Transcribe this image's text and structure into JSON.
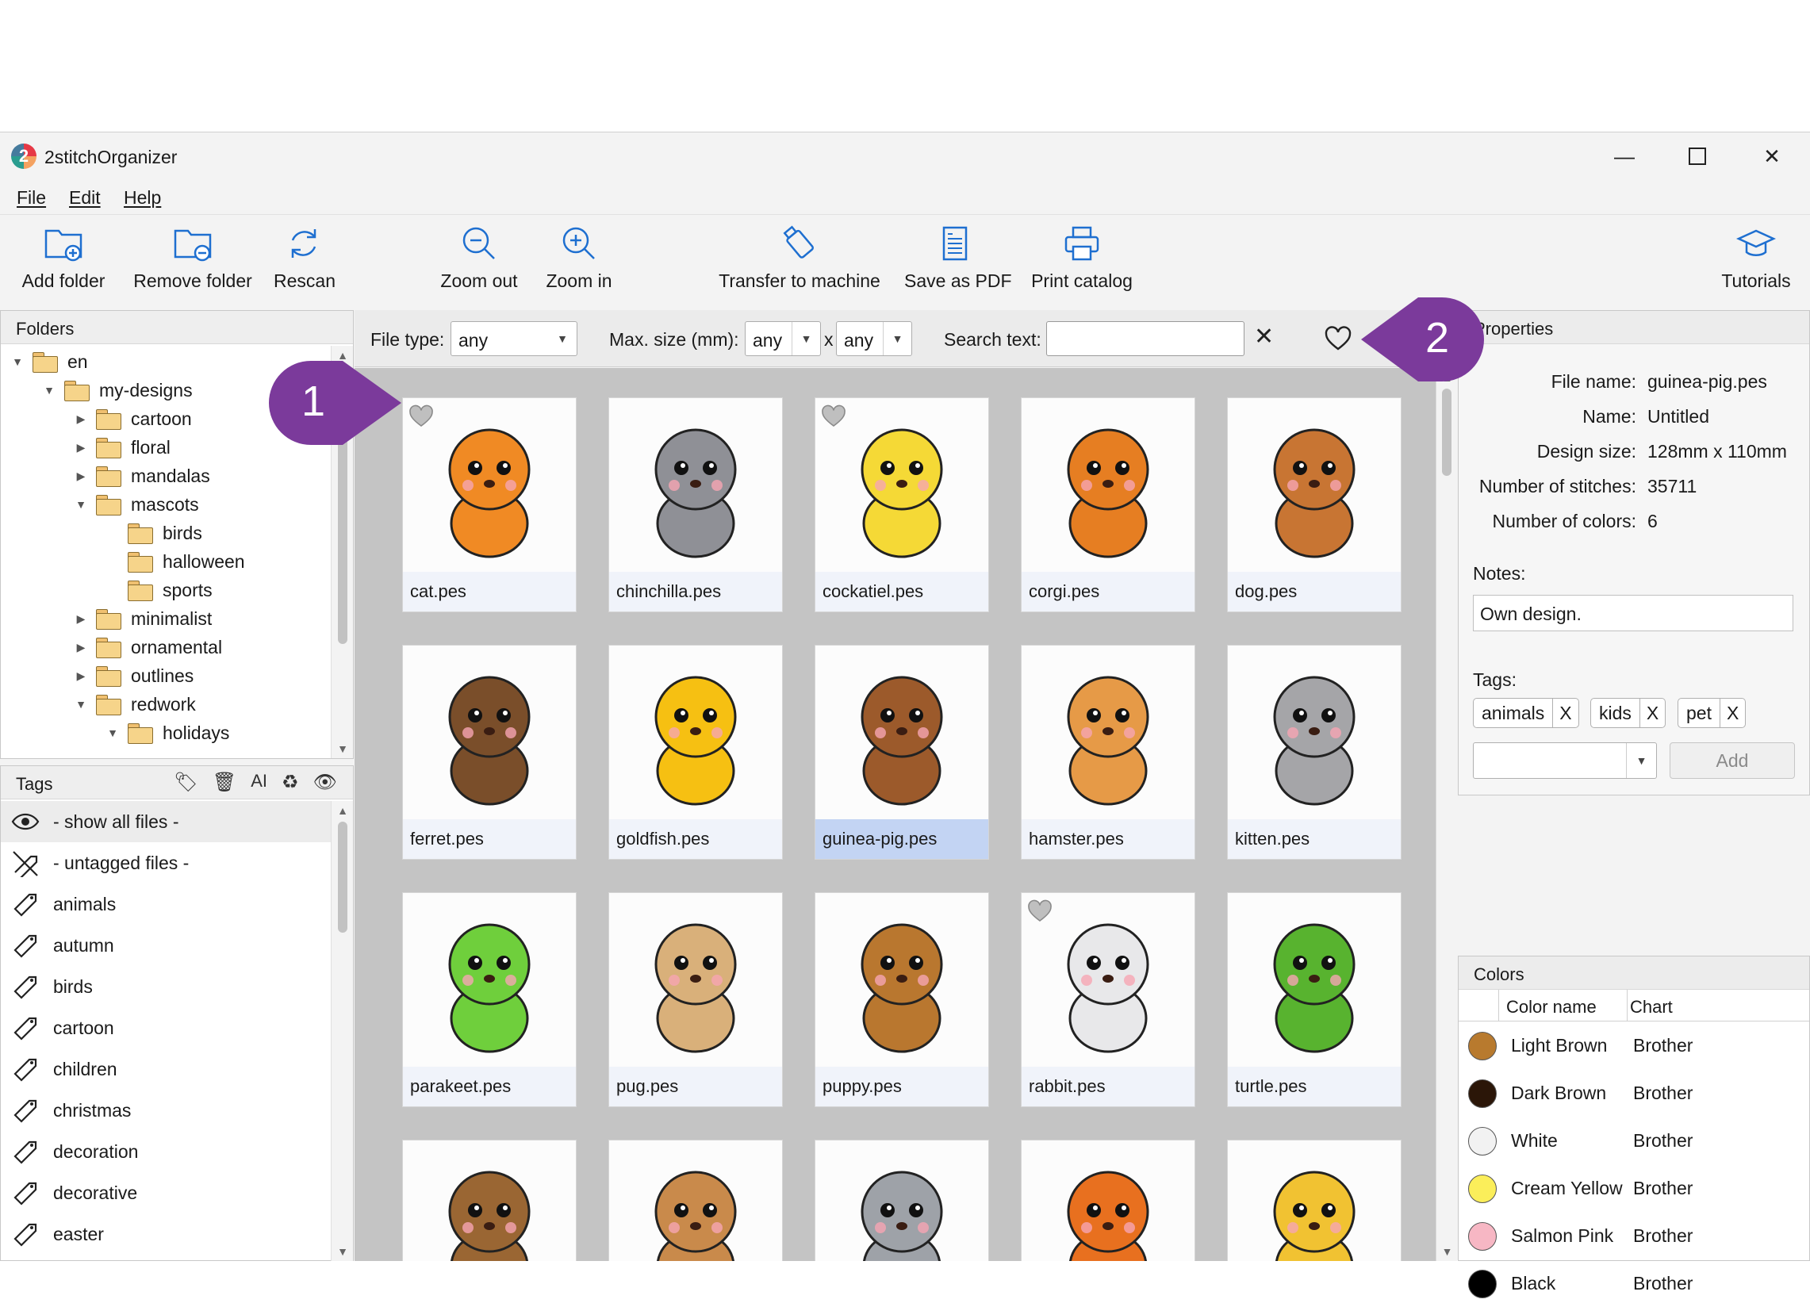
{
  "window": {
    "title": "2stitchOrganizer",
    "logo_text": "2"
  },
  "menu": [
    "File",
    "Edit",
    "Help"
  ],
  "toolbar": {
    "add_folder": "Add folder",
    "remove_folder": "Remove folder",
    "rescan": "Rescan",
    "zoom_out": "Zoom out",
    "zoom_in": "Zoom in",
    "transfer": "Transfer to machine",
    "save_pdf": "Save as PDF",
    "print_catalog": "Print catalog",
    "tutorials": "Tutorials"
  },
  "folders": {
    "title": "Folders",
    "tree": [
      {
        "label": "en",
        "arrow": "▼"
      },
      {
        "label": "my-designs",
        "arrow": "▼"
      },
      {
        "label": "cartoon",
        "arrow": "▶"
      },
      {
        "label": "floral",
        "arrow": "▶"
      },
      {
        "label": "mandalas",
        "arrow": "▶"
      },
      {
        "label": "mascots",
        "arrow": "▼"
      },
      {
        "label": "birds",
        "arrow": ""
      },
      {
        "label": "halloween",
        "arrow": ""
      },
      {
        "label": "sports",
        "arrow": ""
      },
      {
        "label": "minimalist",
        "arrow": "▶"
      },
      {
        "label": "ornamental",
        "arrow": "▶"
      },
      {
        "label": "outlines",
        "arrow": "▶"
      },
      {
        "label": "redwork",
        "arrow": "▼"
      },
      {
        "label": "holidays",
        "arrow": "▼"
      }
    ]
  },
  "tags": {
    "title": "Tags",
    "items": [
      "- show all files -",
      "- untagged files -",
      "animals",
      "autumn",
      "birds",
      "cartoon",
      "children",
      "christmas",
      "decoration",
      "decorative",
      "easter"
    ]
  },
  "filter": {
    "file_type_label": "File type:",
    "file_type_value": "any",
    "max_size_label": "Max. size (mm):",
    "max_w": "any",
    "times": "x",
    "max_h": "any",
    "search_label": "Search text:",
    "search_value": "",
    "clear": "✕"
  },
  "designs": [
    {
      "name": "cat.pes",
      "fav": true,
      "color": "#f08a24"
    },
    {
      "name": "chinchilla.pes",
      "fav": false,
      "color": "#8f9096"
    },
    {
      "name": "cockatiel.pes",
      "fav": true,
      "color": "#f5d936"
    },
    {
      "name": "corgi.pes",
      "fav": false,
      "color": "#e67e22"
    },
    {
      "name": "dog.pes",
      "fav": false,
      "color": "#c87533"
    },
    {
      "name": "ferret.pes",
      "fav": false,
      "color": "#7a4e2a"
    },
    {
      "name": "goldfish.pes",
      "fav": false,
      "color": "#f6c012"
    },
    {
      "name": "guinea-pig.pes",
      "fav": false,
      "color": "#9c5a2b",
      "selected": true
    },
    {
      "name": "hamster.pes",
      "fav": false,
      "color": "#e69a47"
    },
    {
      "name": "kitten.pes",
      "fav": false,
      "color": "#a5a5a8"
    },
    {
      "name": "parakeet.pes",
      "fav": false,
      "color": "#6fcf3c"
    },
    {
      "name": "pug.pes",
      "fav": false,
      "color": "#d9b07a"
    },
    {
      "name": "puppy.pes",
      "fav": false,
      "color": "#b9772f"
    },
    {
      "name": "rabbit.pes",
      "fav": true,
      "color": "#e8e8ea"
    },
    {
      "name": "turtle.pes",
      "fav": false,
      "color": "#58b32f"
    },
    {
      "name": "",
      "fav": false,
      "color": "#9a6633"
    },
    {
      "name": "",
      "fav": false,
      "color": "#c98a4b"
    },
    {
      "name": "",
      "fav": false,
      "color": "#9ea2a8"
    },
    {
      "name": "",
      "fav": false,
      "color": "#e8701f"
    },
    {
      "name": "",
      "fav": false,
      "color": "#f1c232"
    }
  ],
  "properties": {
    "title": "Properties",
    "file_name_label": "File name:",
    "file_name": "guinea-pig.pes",
    "name_label": "Name:",
    "name": "Untitled",
    "design_size_label": "Design size:",
    "design_size": "128mm x 110mm",
    "stitches_label": "Number of stitches:",
    "stitches": "35711",
    "colors_label": "Number of colors:",
    "colors": "6",
    "notes_label": "Notes:",
    "notes": "Own design.",
    "tags_label": "Tags:",
    "tags": [
      "animals",
      "kids",
      "pet"
    ],
    "tag_remove": "X",
    "add_label": "Add"
  },
  "colors": {
    "title": "Colors",
    "col_name": "Color name",
    "col_chart": "Chart",
    "rows": [
      {
        "name": "Light Brown",
        "chart": "Brother",
        "hex": "#b87a2e"
      },
      {
        "name": "Dark Brown",
        "chart": "Brother",
        "hex": "#2b1608"
      },
      {
        "name": "White",
        "chart": "Brother",
        "hex": "#f2f2f2"
      },
      {
        "name": "Cream Yellow",
        "chart": "Brother",
        "hex": "#fbee5a"
      },
      {
        "name": "Salmon Pink",
        "chart": "Brother",
        "hex": "#f7b7c4"
      },
      {
        "name": "Black",
        "chart": "Brother",
        "hex": "#000000"
      }
    ]
  },
  "callouts": [
    "1",
    "2"
  ],
  "accent": "#7b3a9b"
}
